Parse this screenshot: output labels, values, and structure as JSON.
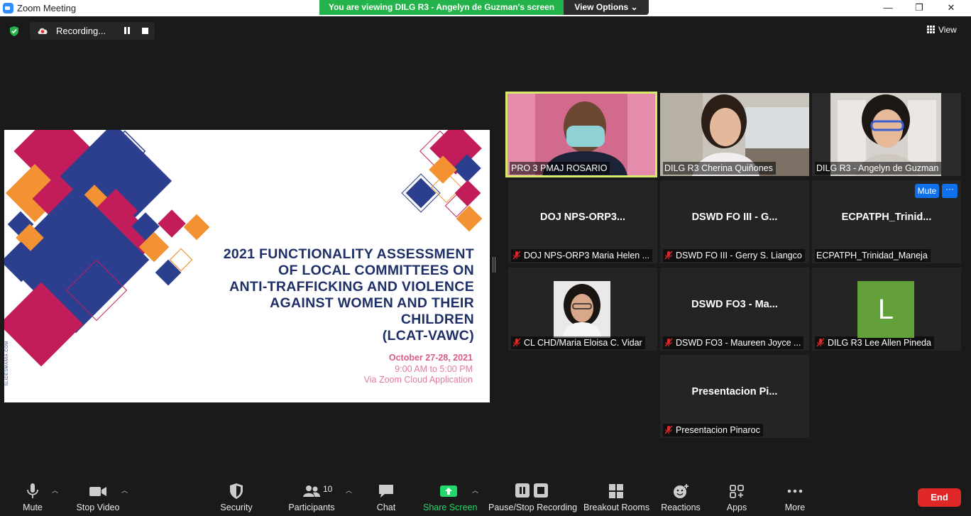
{
  "window": {
    "title": "Zoom Meeting",
    "viewing_banner": "You are viewing DILG R3 - Angelyn de Guzman's screen",
    "view_options": "View Options",
    "minimize": "—",
    "maximize": "❐",
    "close": "✕"
  },
  "top": {
    "recording_label": "Recording...",
    "view_label": "View"
  },
  "slide": {
    "title_lines": [
      "2021 FUNCTIONALITY ASSESSMENT",
      "OF LOCAL COMMITTEES ON",
      "ANTI-TRAFFICKING AND VIOLENCE",
      "AGAINST WOMEN AND THEIR",
      "CHILDREN",
      "(LCAT-VAWC)"
    ],
    "date": "October 27-28, 2021",
    "time": "9:00 AM to 5:00 PM",
    "via": "Via Zoom Cloud Application",
    "watermark": "SLIDESMANIA.COM",
    "colors": {
      "navy": "#1f3068",
      "magenta": "#c21d5a",
      "blue": "#2b3f8e",
      "orange": "#f29233",
      "pink": "#d75b8c"
    }
  },
  "tiles": [
    {
      "title": "",
      "label": "PRO 3 PMAJ ROSARIO",
      "muted": false,
      "video": true
    },
    {
      "title": "",
      "label": "DILG R3 Cherina Quiñones",
      "muted": false,
      "video": true
    },
    {
      "title": "",
      "label": "DILG R3 - Angelyn de Guzman",
      "muted": false,
      "video": true
    },
    {
      "title": "DOJ  NPS-ORP3...",
      "label": "DOJ NPS-ORP3 Maria Helen ...",
      "muted": true
    },
    {
      "title": "DSWD FO III - G...",
      "label": "DSWD FO III - Gerry S. Liangco",
      "muted": true
    },
    {
      "title": "ECPATPH_Trinid...",
      "label": "ECPATPH_Trinidad_Maneja",
      "muted": false
    },
    {
      "title": "",
      "label": "CL CHD/Maria Eloisa C. Vidar",
      "muted": true
    },
    {
      "title": "DSWD  FO3 - Ma...",
      "label": "DSWD FO3 - Maureen Joyce ...",
      "muted": true
    },
    {
      "title": "",
      "label": "DILG R3 Lee Allen Pineda",
      "muted": true,
      "avatar_letter": "L"
    },
    {
      "title": "Presentacion  Pi...",
      "label": "Presentacion Pinaroc",
      "muted": true
    }
  ],
  "tile_buttons": {
    "mute": "Mute",
    "more": "···"
  },
  "toolbar": {
    "mute": "Mute",
    "stop_video": "Stop Video",
    "security": "Security",
    "participants": "Participants",
    "participants_count": "10",
    "chat": "Chat",
    "share_screen": "Share Screen",
    "recording": "Pause/Stop Recording",
    "breakout": "Breakout Rooms",
    "reactions": "Reactions",
    "apps": "Apps",
    "more": "More",
    "end": "End"
  },
  "icons": {
    "security_shield": "shield-check-icon",
    "recording": "cloud-record-icon",
    "muted_mic": "mic-muted-icon"
  }
}
